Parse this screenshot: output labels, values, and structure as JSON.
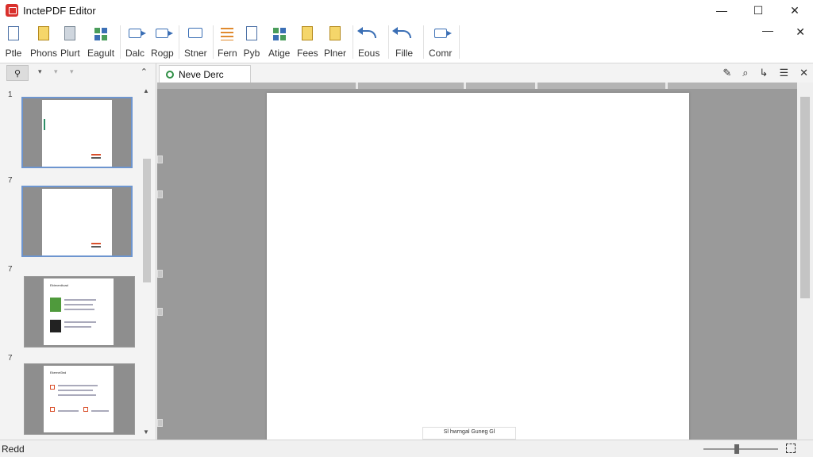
{
  "window": {
    "title": "InctePDF Editor",
    "minimize": "—",
    "maximize": "☐",
    "close": "✕"
  },
  "ribbon": {
    "tools": [
      {
        "id": "file",
        "label": "Ptle",
        "icon": "document-icon"
      },
      {
        "id": "photos",
        "label": "Phons",
        "icon": "image-edit-icon"
      },
      {
        "id": "print",
        "label": "Plurt",
        "icon": "stack-icon"
      },
      {
        "id": "export",
        "label": "Eagult",
        "icon": "crop-icon"
      },
      {
        "id": "select",
        "label": "Dalc",
        "icon": "select-arrow-icon"
      },
      {
        "id": "hop",
        "label": "Rogp",
        "icon": "forward-icon"
      },
      {
        "id": "share",
        "label": "Stner",
        "icon": "comment-icon"
      },
      {
        "id": "form",
        "label": "Fern",
        "icon": "list-icon"
      },
      {
        "id": "pyb",
        "label": "Pyb",
        "icon": "badge-doc-icon"
      },
      {
        "id": "arrange",
        "label": "Atige",
        "icon": "grid-icon"
      },
      {
        "id": "fees",
        "label": "Fees",
        "icon": "page-icon"
      },
      {
        "id": "place",
        "label": "Plner",
        "icon": "pen-doc-icon"
      },
      {
        "id": "undo",
        "label": "Eous",
        "icon": "undo-icon"
      },
      {
        "id": "fille",
        "label": "Fille",
        "icon": "share-icon"
      },
      {
        "id": "comm",
        "label": "Comr",
        "icon": "export-icon"
      }
    ],
    "minimize": "—",
    "close": "✕"
  },
  "left_panel": {
    "thumb_numbers": [
      "1",
      "7",
      "7",
      "7"
    ],
    "collapse": "⌃",
    "scroll_up": "▲",
    "scroll_down": "▼",
    "page3_header": "Ektrnerdtoad",
    "page4_header": "Ekernel3nd"
  },
  "tabs": [
    {
      "label": "Neve Derc",
      "active": true
    }
  ],
  "tab_actions": [
    "✎",
    "⌕",
    "↳",
    "☰",
    "✕"
  ],
  "document": {
    "stamp_text": "Sl hwrngal Guneg Gl"
  },
  "status": {
    "text": "Redd",
    "zoom_fraction": 0.45
  }
}
